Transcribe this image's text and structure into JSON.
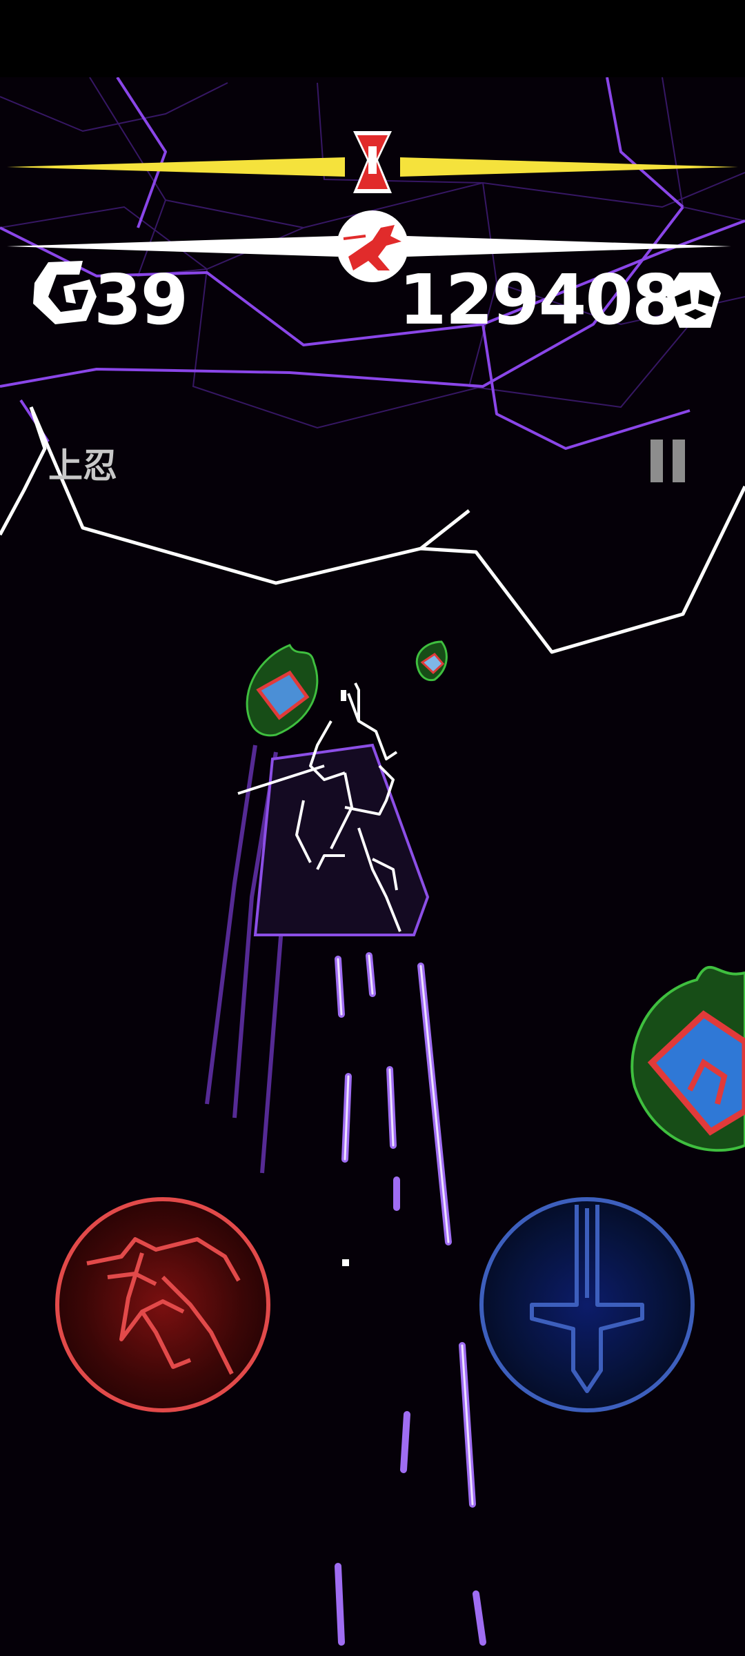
{
  "hud": {
    "shuriken_icon": "spiral-g-icon",
    "shuriken_count": "39",
    "score": "129408",
    "skull_icon": "skull-icon",
    "runner_icon": "running-ninja-icon",
    "hourglass_icon": "hourglass-icon",
    "rank_label": "上忍",
    "pause_icon": "pause-icon"
  },
  "controls": {
    "jump_icon": "ninja-jump-icon",
    "attack_icon": "sword-icon"
  },
  "colors": {
    "background": "#050008",
    "wireframe": "#7a3cd0",
    "wireframe_bright": "#ffffff",
    "time_bar": "#f5e23c",
    "distance_bar": "#ffffff",
    "jump_button": "#e24a4a",
    "attack_button": "#3d5fbd",
    "pickup_glow": "#2fa82f"
  }
}
